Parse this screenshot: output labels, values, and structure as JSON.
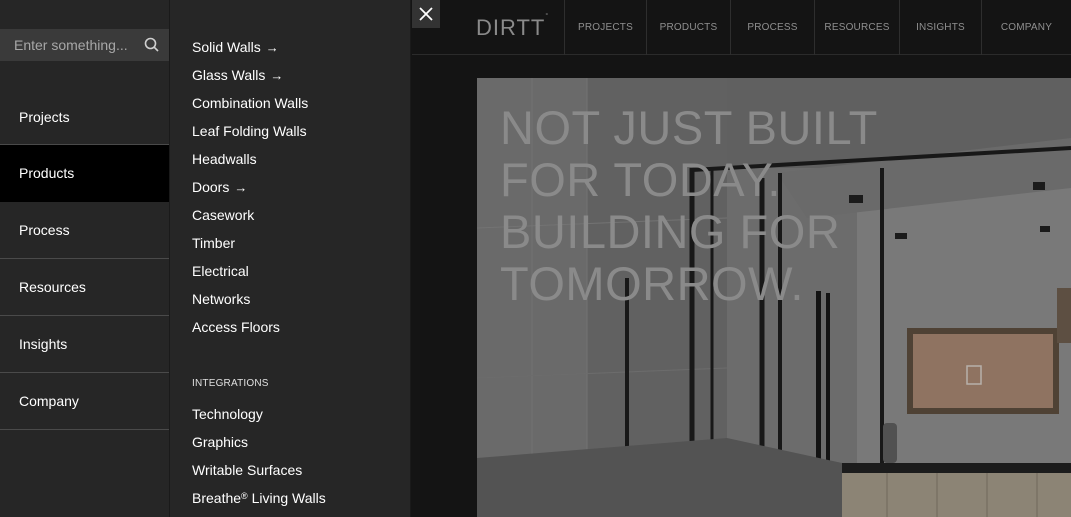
{
  "search": {
    "placeholder": "Enter something..."
  },
  "nav": {
    "items": [
      {
        "label": "Projects"
      },
      {
        "label": "Products"
      },
      {
        "label": "Process"
      },
      {
        "label": "Resources"
      },
      {
        "label": "Insights"
      },
      {
        "label": "Company"
      }
    ],
    "active": "Products"
  },
  "submenu": {
    "items": [
      {
        "label": "Solid Walls",
        "arrow": "→"
      },
      {
        "label": "Glass Walls",
        "arrow": "→"
      },
      {
        "label": "Combination Walls"
      },
      {
        "label": "Leaf Folding Walls"
      },
      {
        "label": "Headwalls"
      },
      {
        "label": "Doors",
        "arrow": "→"
      },
      {
        "label": "Casework"
      },
      {
        "label": "Timber"
      },
      {
        "label": "Electrical"
      },
      {
        "label": "Networks"
      },
      {
        "label": "Access Floors"
      }
    ],
    "integrations_heading": "INTEGRATIONS",
    "integrations": [
      {
        "label": "Technology"
      },
      {
        "label": "Graphics"
      },
      {
        "label": "Writable Surfaces"
      },
      {
        "label": "Breathe",
        "sup": "®",
        "suffix": " Living Walls"
      }
    ]
  },
  "header": {
    "logo": "DIRTT",
    "logo_mark": "°",
    "nav": [
      {
        "label": "PROJECTS"
      },
      {
        "label": "PRODUCTS"
      },
      {
        "label": "PROCESS"
      },
      {
        "label": "RESOURCES"
      },
      {
        "label": "INSIGHTS"
      },
      {
        "label": "COMPANY"
      }
    ]
  },
  "hero": {
    "headline_lines": [
      "NOT JUST BUILT",
      "FOR TODAY.",
      "BUILDING FOR",
      "TOMORROW."
    ]
  },
  "colors": {
    "panel_bg": "#262626",
    "active_bg": "#000000",
    "search_bg": "#3a3a3a",
    "page_bg": "#141414"
  }
}
